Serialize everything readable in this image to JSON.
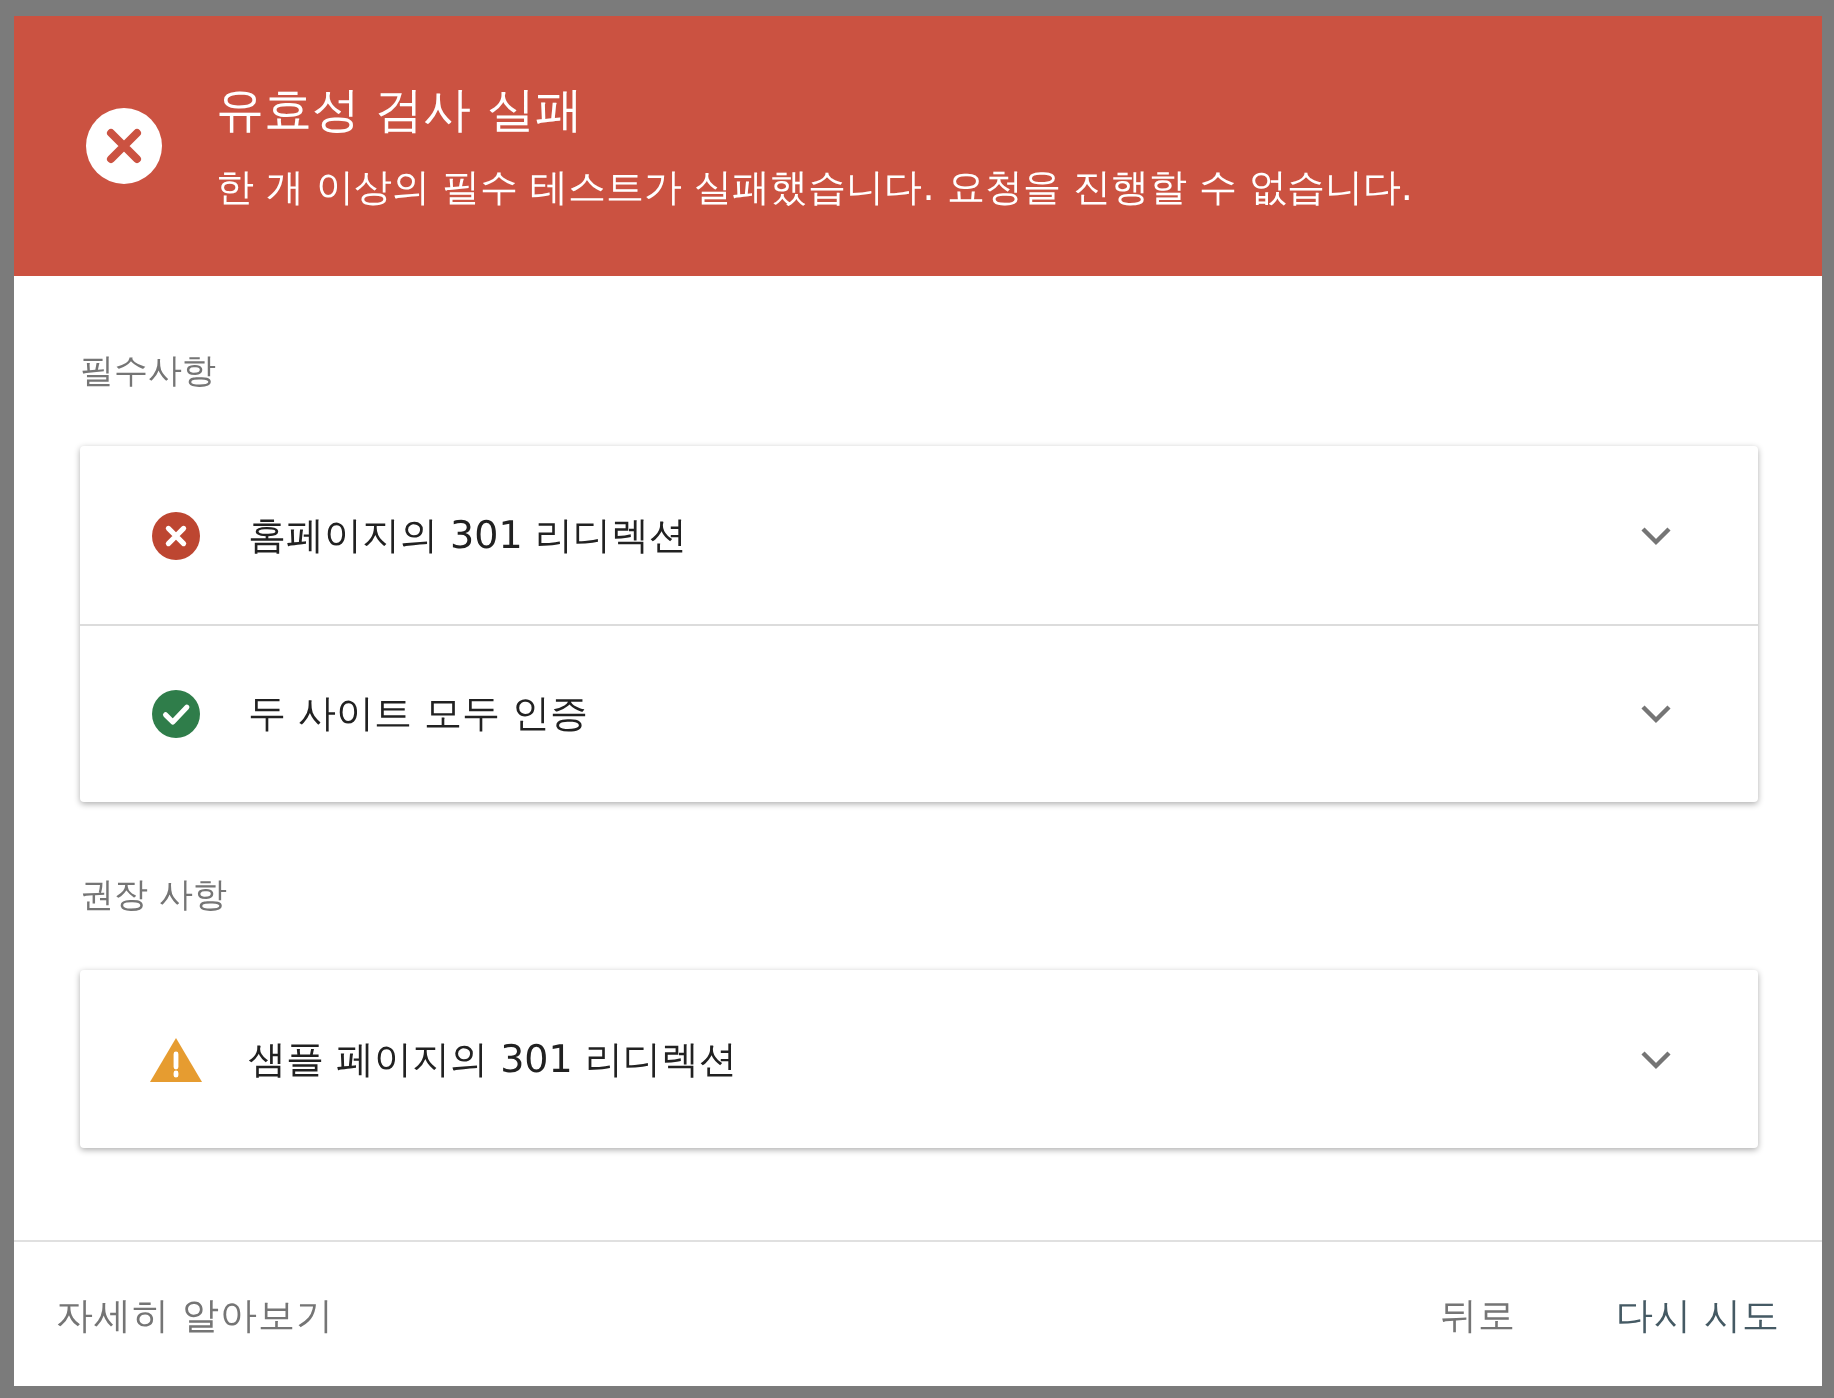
{
  "dialog": {
    "header": {
      "kind": "error",
      "title": "유효성 검사 실패",
      "message": "한 개 이상의 필수 테스트가 실패했습니다. 요청을 진행할 수 없습니다."
    },
    "sections": [
      {
        "heading": "필수사항",
        "items": [
          {
            "label": "홈페이지의 301 리디렉션",
            "kind": "fail",
            "expanded": false
          },
          {
            "label": "두 사이트 모두 인증",
            "kind": "pass",
            "expanded": false
          }
        ]
      },
      {
        "heading": "권장 사항",
        "items": [
          {
            "label": "샘플 페이지의 301 리디렉션",
            "kind": "warning",
            "expanded": false
          }
        ]
      }
    ],
    "footer": {
      "link": "자세히 알아보기",
      "buttons": [
        {
          "label": "뒤로",
          "kind": "secondary"
        },
        {
          "label": "다시 시도",
          "kind": "primary"
        }
      ]
    }
  }
}
